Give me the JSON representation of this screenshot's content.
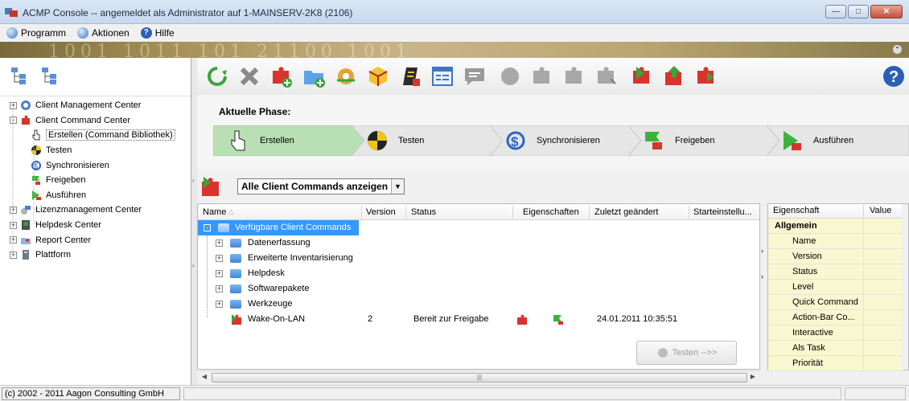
{
  "window": {
    "title": "ACMP Console -- angemeldet als Administrator auf 1-MAINSERV-2K8 (2106)"
  },
  "menu": {
    "items": [
      {
        "label": "Programm",
        "icon": "program-icon"
      },
      {
        "label": "Aktionen",
        "icon": "actions-icon"
      },
      {
        "label": "Hilfe",
        "icon": "help-icon"
      }
    ]
  },
  "banner": {
    "digits": "1001 1011 101 21100 1001"
  },
  "tree": {
    "items": [
      {
        "label": "Client Management Center",
        "expander": "+",
        "level": 0
      },
      {
        "label": "Client Command Center",
        "expander": "-",
        "level": 0
      },
      {
        "label": "Erstellen (Command Bibliothek)",
        "level": 1,
        "selected": true
      },
      {
        "label": "Testen",
        "level": 1
      },
      {
        "label": "Synchronisieren",
        "level": 1
      },
      {
        "label": "Freigeben",
        "level": 1
      },
      {
        "label": "Ausführen",
        "level": 1
      },
      {
        "label": "Lizenzmanagement Center",
        "expander": "+",
        "level": 0
      },
      {
        "label": "Helpdesk Center",
        "expander": "+",
        "level": 0
      },
      {
        "label": "Report Center",
        "expander": "+",
        "level": 0
      },
      {
        "label": "Plattform",
        "expander": "+",
        "level": 0
      }
    ]
  },
  "phases": {
    "label": "Aktuelle Phase:",
    "steps": [
      {
        "label": "Erstellen",
        "active": true
      },
      {
        "label": "Testen",
        "active": false
      },
      {
        "label": "Synchronisieren",
        "active": false
      },
      {
        "label": "Freigeben",
        "active": false
      },
      {
        "label": "Ausführen",
        "active": false
      }
    ]
  },
  "filter": {
    "selected": "Alle Client Commands anzeigen"
  },
  "grid": {
    "columns": [
      "Name",
      "Version",
      "Status",
      "Eigenschaften",
      "Zuletzt geändert",
      "Starteinstellu..."
    ],
    "root": "Verfügbare Client Commands",
    "folders": [
      "Datenerfassung",
      "Erweiterte Inventarisierung",
      "Helpdesk",
      "Softwarepakete",
      "Werkzeuge"
    ],
    "item": {
      "name": "Wake-On-LAN",
      "version": "2",
      "status": "Bereit zur Freigabe",
      "changed": "24.01.2011 10:35:51"
    },
    "test_button": "Testen -->>"
  },
  "properties": {
    "col_property": "Eigenschaft",
    "col_value": "Value",
    "category": "Allgemein",
    "rows": [
      "Name",
      "Version",
      "Status",
      "Level",
      "Quick Command",
      "Action-Bar Co...",
      "Interactive",
      "Als Task",
      "Priorität"
    ]
  },
  "statusbar": {
    "copyright": "(c) 2002 - 2011 Aagon Consulting GmbH"
  },
  "colors": {
    "selection": "#3399ff",
    "active_phase": "#b9e0b4",
    "prop_value_bg": "#f9f7cf"
  }
}
